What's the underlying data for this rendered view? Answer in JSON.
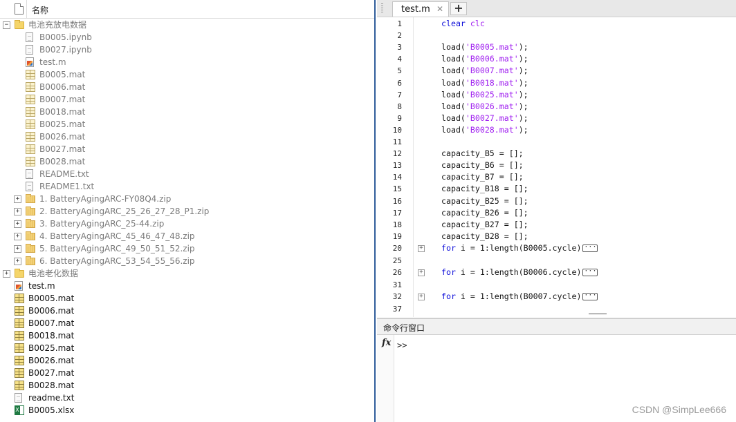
{
  "browser": {
    "header_label": "名称",
    "rows": [
      {
        "label": "电池充放电数据",
        "icon": "folder-icon",
        "expander": "−"
      },
      {
        "label": "B0005.ipynb",
        "icon": "document-icon"
      },
      {
        "label": "B0027.ipynb",
        "icon": "document-icon"
      },
      {
        "label": "test.m",
        "icon": "matlab-script-icon"
      },
      {
        "label": "B0005.mat",
        "icon": "mat-file-icon"
      },
      {
        "label": "B0006.mat",
        "icon": "mat-file-icon"
      },
      {
        "label": "B0007.mat",
        "icon": "mat-file-icon"
      },
      {
        "label": "B0018.mat",
        "icon": "mat-file-icon"
      },
      {
        "label": "B0025.mat",
        "icon": "mat-file-icon"
      },
      {
        "label": "B0026.mat",
        "icon": "mat-file-icon"
      },
      {
        "label": "B0027.mat",
        "icon": "mat-file-icon"
      },
      {
        "label": "B0028.mat",
        "icon": "mat-file-icon"
      },
      {
        "label": "README.txt",
        "icon": "document-icon"
      },
      {
        "label": "README1.txt",
        "icon": "document-icon"
      },
      {
        "label": "1. BatteryAgingARC-FY08Q4.zip",
        "icon": "zip-folder-icon",
        "expander": "+"
      },
      {
        "label": "2. BatteryAgingARC_25_26_27_28_P1.zip",
        "icon": "zip-folder-icon",
        "expander": "+"
      },
      {
        "label": "3. BatteryAgingARC_25-44.zip",
        "icon": "zip-folder-icon",
        "expander": "+"
      },
      {
        "label": "4. BatteryAgingARC_45_46_47_48.zip",
        "icon": "zip-folder-icon",
        "expander": "+"
      },
      {
        "label": "5. BatteryAgingARC_49_50_51_52.zip",
        "icon": "zip-folder-icon",
        "expander": "+"
      },
      {
        "label": "6. BatteryAgingARC_53_54_55_56.zip",
        "icon": "zip-folder-icon",
        "expander": "+"
      },
      {
        "label": "电池老化数据",
        "icon": "folder-icon",
        "expander": "+"
      },
      {
        "label": "test.m",
        "icon": "matlab-script-icon"
      },
      {
        "label": "B0005.mat",
        "icon": "mat-file-icon"
      },
      {
        "label": "B0006.mat",
        "icon": "mat-file-icon"
      },
      {
        "label": "B0007.mat",
        "icon": "mat-file-icon"
      },
      {
        "label": "B0018.mat",
        "icon": "mat-file-icon"
      },
      {
        "label": "B0025.mat",
        "icon": "mat-file-icon"
      },
      {
        "label": "B0026.mat",
        "icon": "mat-file-icon"
      },
      {
        "label": "B0027.mat",
        "icon": "mat-file-icon"
      },
      {
        "label": "B0028.mat",
        "icon": "mat-file-icon"
      },
      {
        "label": "readme.txt",
        "icon": "document-icon"
      },
      {
        "label": "B0005.xlsx",
        "icon": "excel-file-icon"
      }
    ]
  },
  "editor": {
    "tab_label": "test.m",
    "tab_close": "✕",
    "add_tab": "+",
    "ellipsis": "···",
    "lines": [
      {
        "n": "1",
        "code": [
          {
            "t": "clear ",
            "c": "kw"
          },
          {
            "t": "clc",
            "c": "str"
          }
        ]
      },
      {
        "n": "2",
        "code": []
      },
      {
        "n": "3",
        "code": [
          {
            "t": "load(",
            "c": ""
          },
          {
            "t": "'B0005.mat'",
            "c": "str"
          },
          {
            "t": ");",
            "c": ""
          }
        ]
      },
      {
        "n": "4",
        "code": [
          {
            "t": "load(",
            "c": ""
          },
          {
            "t": "'B0006.mat'",
            "c": "str"
          },
          {
            "t": ");",
            "c": ""
          }
        ]
      },
      {
        "n": "5",
        "code": [
          {
            "t": "load(",
            "c": ""
          },
          {
            "t": "'B0007.mat'",
            "c": "str"
          },
          {
            "t": ");",
            "c": ""
          }
        ]
      },
      {
        "n": "6",
        "code": [
          {
            "t": "load(",
            "c": ""
          },
          {
            "t": "'B0018.mat'",
            "c": "str"
          },
          {
            "t": ");",
            "c": ""
          }
        ]
      },
      {
        "n": "7",
        "code": [
          {
            "t": "load(",
            "c": ""
          },
          {
            "t": "'B0025.mat'",
            "c": "str"
          },
          {
            "t": ");",
            "c": ""
          }
        ]
      },
      {
        "n": "8",
        "code": [
          {
            "t": "load(",
            "c": ""
          },
          {
            "t": "'B0026.mat'",
            "c": "str"
          },
          {
            "t": ");",
            "c": ""
          }
        ]
      },
      {
        "n": "9",
        "code": [
          {
            "t": "load(",
            "c": ""
          },
          {
            "t": "'B0027.mat'",
            "c": "str"
          },
          {
            "t": ");",
            "c": ""
          }
        ]
      },
      {
        "n": "10",
        "code": [
          {
            "t": "load(",
            "c": ""
          },
          {
            "t": "'B0028.mat'",
            "c": "str"
          },
          {
            "t": ");",
            "c": ""
          }
        ]
      },
      {
        "n": "11",
        "code": []
      },
      {
        "n": "12",
        "code": [
          {
            "t": "capacity_B5 = [];",
            "c": ""
          }
        ]
      },
      {
        "n": "13",
        "code": [
          {
            "t": "capacity_B6 = [];",
            "c": ""
          }
        ]
      },
      {
        "n": "14",
        "code": [
          {
            "t": "capacity_B7 = [];",
            "c": ""
          }
        ]
      },
      {
        "n": "15",
        "code": [
          {
            "t": "capacity_B18 = [];",
            "c": ""
          }
        ]
      },
      {
        "n": "16",
        "code": [
          {
            "t": "capacity_B25 = [];",
            "c": ""
          }
        ]
      },
      {
        "n": "17",
        "code": [
          {
            "t": "capacity_B26 = [];",
            "c": ""
          }
        ]
      },
      {
        "n": "18",
        "code": [
          {
            "t": "capacity_B27 = [];",
            "c": ""
          }
        ]
      },
      {
        "n": "19",
        "code": [
          {
            "t": "capacity_B28 = [];",
            "c": ""
          }
        ]
      },
      {
        "n": "20",
        "fold": true,
        "code": [
          {
            "t": "for",
            "c": "kw"
          },
          {
            "t": " i = 1:length(B0005.cycle)",
            "c": ""
          }
        ]
      },
      {
        "n": "25",
        "gap": true,
        "code": []
      },
      {
        "n": "26",
        "fold": true,
        "gap": true,
        "code": [
          {
            "t": "for",
            "c": "kw"
          },
          {
            "t": " i = 1:length(B0006.cycle)",
            "c": ""
          }
        ]
      },
      {
        "n": "31",
        "gap": true,
        "code": []
      },
      {
        "n": "32",
        "fold": true,
        "gap": true,
        "code": [
          {
            "t": "for",
            "c": "kw"
          },
          {
            "t": " i = 1:length(B0007.cycle)",
            "c": ""
          }
        ]
      },
      {
        "n": "37",
        "gap": true,
        "code": []
      }
    ]
  },
  "command_window": {
    "title": "命令行窗口",
    "fx": "fx",
    "prompt": ">>"
  },
  "watermark": "CSDN @SimpLee666"
}
